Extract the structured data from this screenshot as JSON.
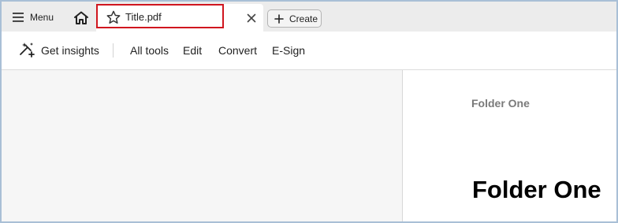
{
  "tabbar": {
    "menu_label": "Menu",
    "menu_icon": "hamburger-icon",
    "home_icon": "home-icon",
    "tab": {
      "title": "Title.pdf",
      "star_icon": "star-icon",
      "close_icon": "close-icon",
      "highlight_color": "#d0161f"
    },
    "create_label": "Create",
    "create_icon": "plus-icon"
  },
  "toolbar": {
    "insights_icon": "ai-sparkle-icon",
    "items": [
      "Get insights",
      "All tools",
      "Edit",
      "Convert",
      "E-Sign"
    ]
  },
  "document": {
    "header": "Folder One",
    "heading": "Folder One"
  }
}
